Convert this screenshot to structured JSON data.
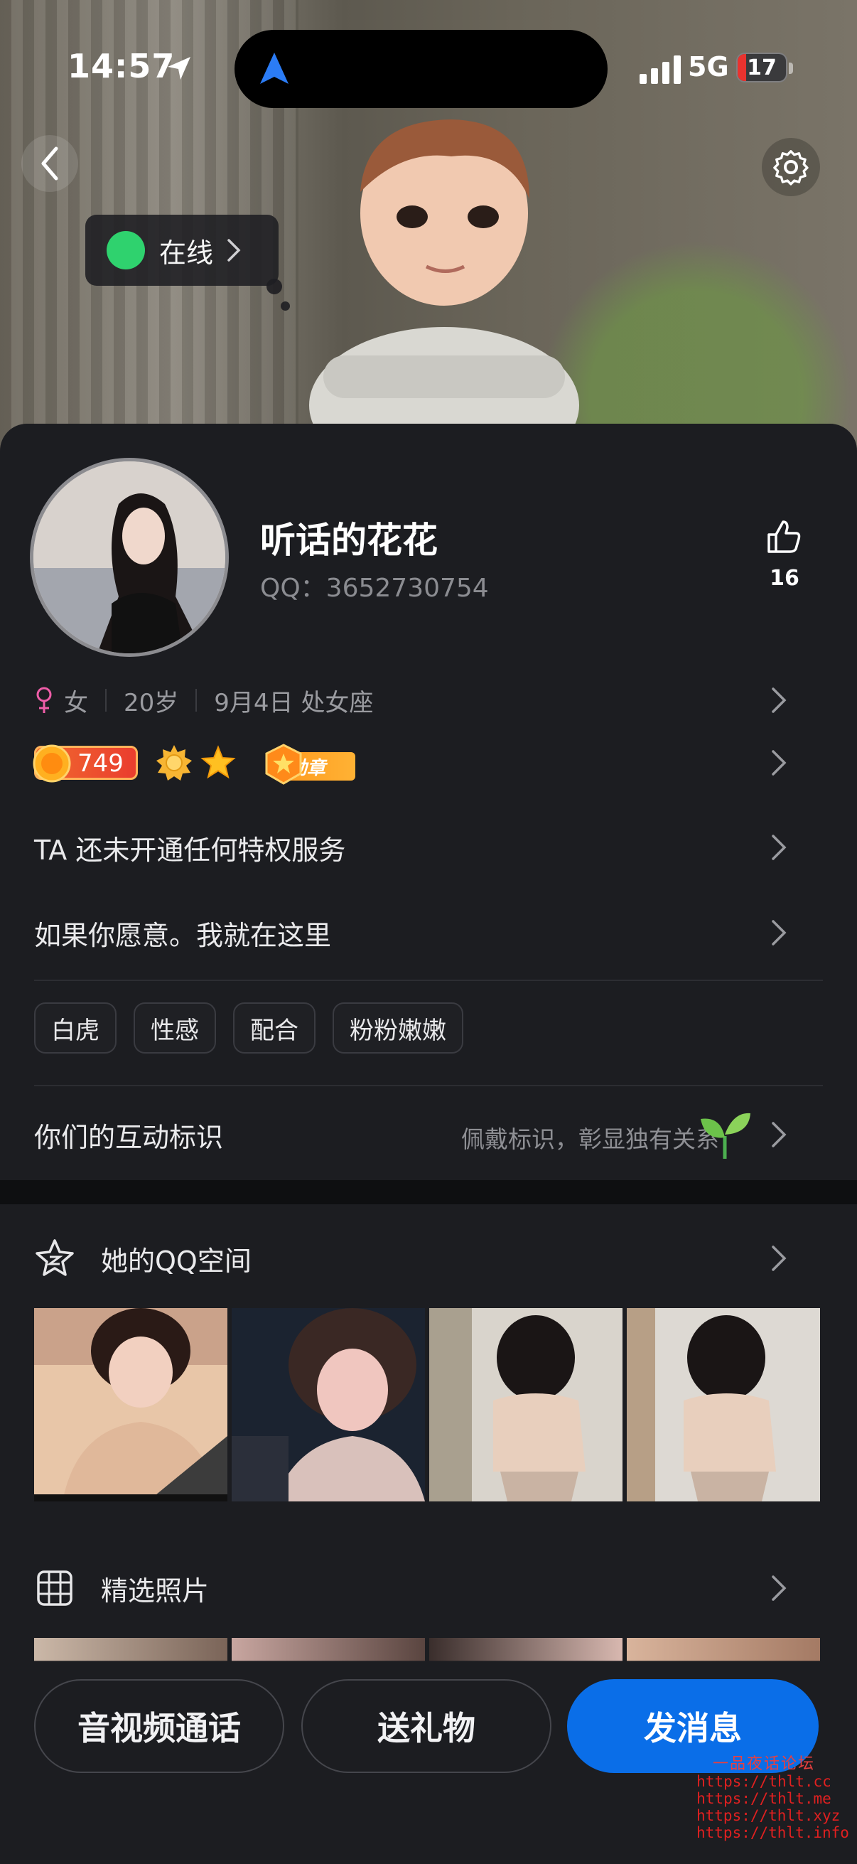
{
  "status_bar": {
    "time": "14:57",
    "network": "5G",
    "battery": "17",
    "battery_level": 0.17
  },
  "header": {
    "online_label": "在线"
  },
  "profile": {
    "name": "听话的花花",
    "qq": "QQ：3652730754",
    "likes": "16",
    "gender": "女",
    "age": "20岁",
    "birthday": "9月4日 处女座",
    "level": "749",
    "medal_label": "勋章",
    "privilege_text": "TA 还未开通任何特权服务",
    "signature": "如果你愿意。我就在这里",
    "tags": [
      "白虎",
      "性感",
      "配合",
      "粉粉嫩嫩"
    ],
    "interaction_title": "你们的互动标识",
    "interaction_desc": "佩戴标识，彰显独有关系"
  },
  "sections": {
    "qzone_title": "她的QQ空间",
    "photos_title": "精选照片"
  },
  "actions": {
    "call": "音视频通话",
    "gift": "送礼物",
    "message": "发消息"
  },
  "watermark": {
    "title": "一品夜话论坛",
    "links": [
      "https://thlt.cc",
      "https://thlt.me",
      "https://thlt.xyz",
      "https://thlt.info"
    ]
  },
  "icons": [
    "location-arrow-icon",
    "back-icon",
    "settings-gear-icon",
    "thumbs-up-icon",
    "female-icon",
    "chevron-right-icon",
    "qzone-star-icon",
    "grid-icon",
    "sprout-icon"
  ],
  "colors": {
    "accent": "#0a6ee8",
    "online": "#2fd26e",
    "level": "#ea3d2e",
    "medal": "#ffa326"
  }
}
